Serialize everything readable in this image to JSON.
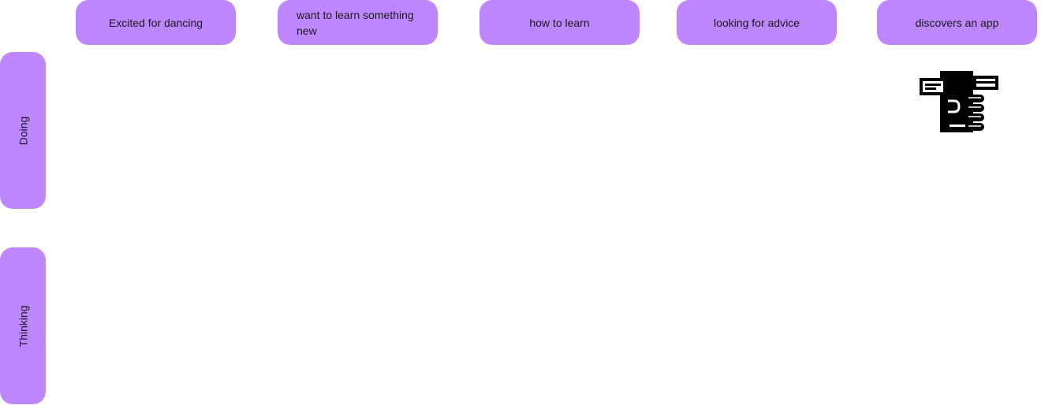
{
  "stages": [
    {
      "label": "Excited for dancing"
    },
    {
      "label": "want to learn something new"
    },
    {
      "label": "how to learn"
    },
    {
      "label": "looking for advice"
    },
    {
      "label": "discovers an app"
    }
  ],
  "lanes": [
    {
      "label": "Doing"
    },
    {
      "label": "Thinking"
    }
  ],
  "colors": {
    "card_fill": "#bf87fd",
    "icon": "#000000"
  },
  "icons": {
    "discovers_app": "hand-holding-phone-icon"
  }
}
